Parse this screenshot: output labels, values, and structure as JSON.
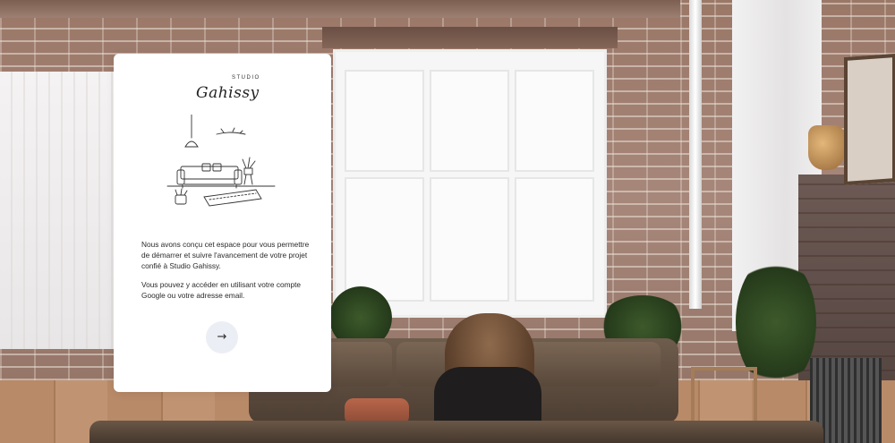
{
  "brand": {
    "overline": "STUDIO",
    "script_name": "Gahissy"
  },
  "welcome": {
    "paragraph_1": "Nous avons conçu cet espace pour vous permettre de démarrer et suivre l'avancement de votre projet confié à Studio Gahissy.",
    "paragraph_2": "Vous pouvez y accéder en utilisant votre compte Google ou votre adresse email."
  },
  "actions": {
    "next_glyph": "→",
    "next_icon": "arrow-right-icon"
  },
  "illustration": {
    "icon": "living-room-sketch-icon"
  },
  "colors": {
    "card_background": "#ffffff",
    "button_background": "#eceef6",
    "text": "#2a2a2a"
  }
}
